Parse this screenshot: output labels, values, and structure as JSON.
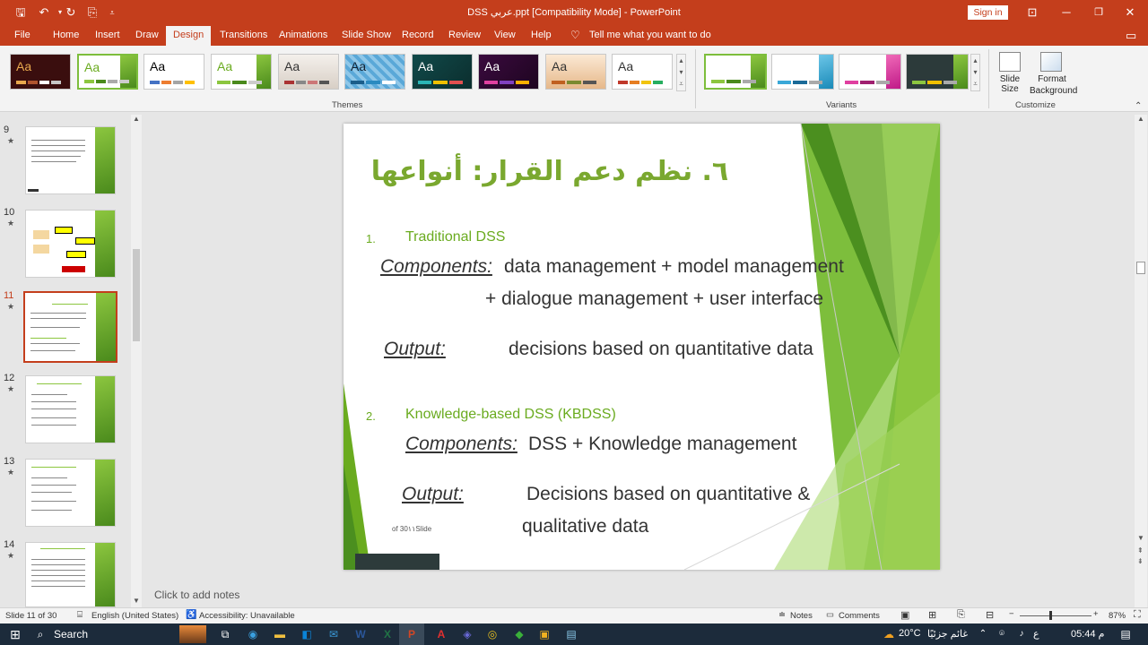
{
  "window": {
    "title": "DSS عربي.ppt [Compatibility Mode]  -  PowerPoint",
    "signin": "Sign in"
  },
  "tabs": [
    "File",
    "Home",
    "Insert",
    "Draw",
    "Design",
    "Transitions",
    "Animations",
    "Slide Show",
    "Record",
    "Review",
    "View",
    "Help"
  ],
  "tell_me": "Tell me what you want to do",
  "ribbon": {
    "themes_label": "Themes",
    "variants_label": "Variants",
    "customize_label": "Customize",
    "slide_size": "Slide Size",
    "format_background_1": "Format",
    "format_background_2": "Background",
    "theme_aa": "Aa"
  },
  "thumbnails": [
    {
      "num": "9"
    },
    {
      "num": "10"
    },
    {
      "num": "11"
    },
    {
      "num": "12"
    },
    {
      "num": "13"
    },
    {
      "num": "14"
    }
  ],
  "slide": {
    "title": "٦. نظم دعم القرار: أنواعها",
    "item1_num": "1.",
    "item1_label": "Traditional DSS",
    "components1_label": "Components:",
    "components1_line1": "data management + model management",
    "components1_line2": "+ dialogue management + user interface",
    "output1_label": "Output:",
    "output1_text": "decisions based on quantitative data",
    "item2_num": "2.",
    "item2_label": "Knowledge-based DSS (KBDSS)",
    "components2_label": "Components:",
    "components2_text": "DSS + Knowledge management",
    "output2_label": "Output:",
    "output2_line1": "Decisions based on quantitative &",
    "output2_line2": "qualitative data",
    "footer": "of 30١١Slide"
  },
  "notes_placeholder": "Click to add notes",
  "status": {
    "slide_count": "Slide 11 of 30",
    "language": "English (United States)",
    "accessibility": "Accessibility: Unavailable",
    "notes": "Notes",
    "comments": "Comments",
    "zoom": "87%"
  },
  "taskbar": {
    "search": "Search",
    "temp": "20°C",
    "weather": "غائم جزئيًا",
    "time": "05:44 م",
    "lang": "ع"
  },
  "colors": {
    "accent": "#c43e1c",
    "slide_green": "#8cc63f",
    "title_green": "#6aab1f"
  }
}
